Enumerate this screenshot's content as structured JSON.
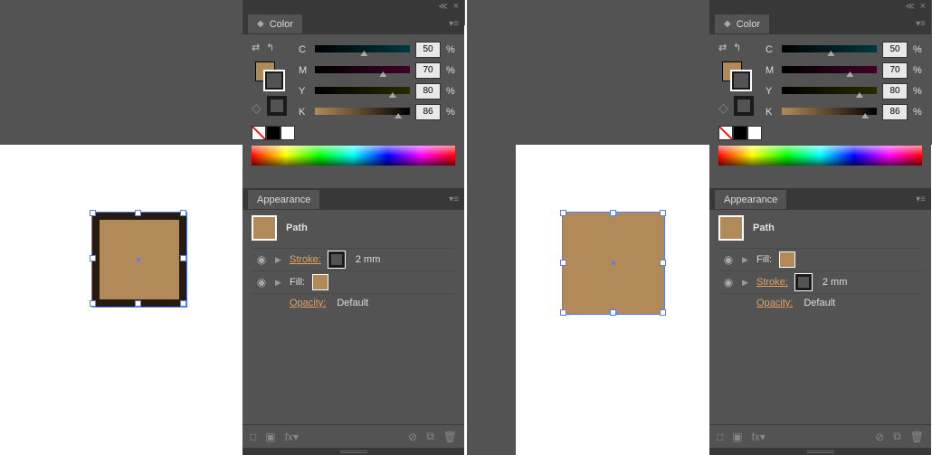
{
  "colors": {
    "fill": "#b28a5a",
    "stroke": "#1a1a1a",
    "accent": "#e8a05a"
  },
  "panels": {
    "color": {
      "title": "Color",
      "channels": [
        {
          "label": "C",
          "value": "50",
          "gradient": "linear-gradient(to right,#000,#005560)"
        },
        {
          "label": "M",
          "value": "70",
          "gradient": "linear-gradient(to right,#000,#550030)"
        },
        {
          "label": "Y",
          "value": "80",
          "gradient": "linear-gradient(to right,#000,#353500)"
        },
        {
          "label": "K",
          "value": "86",
          "gradient": "linear-gradient(to right,#b28a5a,#000)"
        }
      ],
      "percent": "%"
    },
    "appearance": {
      "title": "Appearance",
      "path_label": "Path",
      "stroke_label": "Stroke:",
      "stroke_value": "2 mm",
      "fill_label": "Fill:",
      "opacity_label": "Opacity:",
      "opacity_value": "Default"
    }
  },
  "left": {
    "appearance_order": [
      "stroke",
      "fill"
    ]
  },
  "right": {
    "appearance_order": [
      "fill",
      "stroke"
    ]
  }
}
